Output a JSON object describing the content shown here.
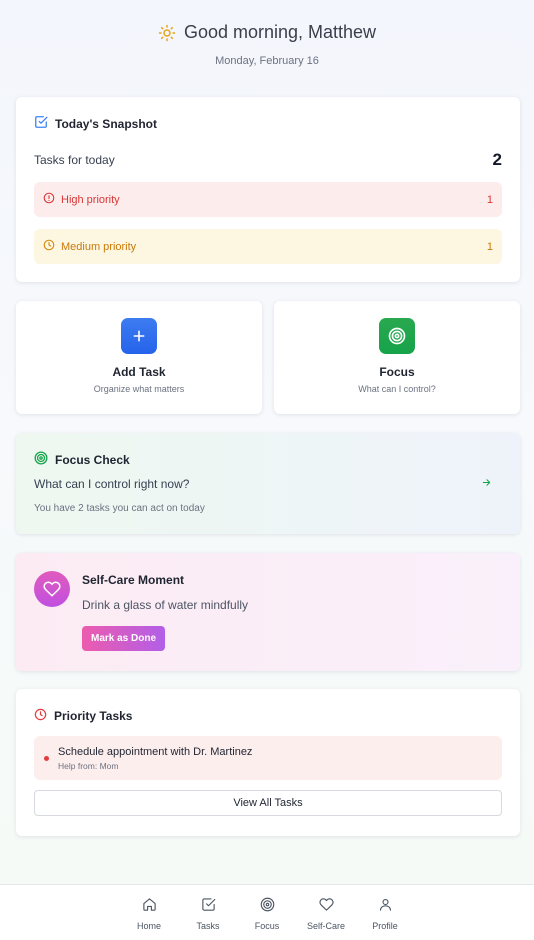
{
  "header": {
    "greeting": "Good morning, Matthew",
    "date": "Monday, February 16",
    "icon": "sun-icon"
  },
  "snapshot": {
    "title": "Today's Snapshot",
    "tasks_label": "Tasks for today",
    "tasks_count": "2",
    "high_label": "High priority",
    "high_count": "1",
    "medium_label": "Medium priority",
    "medium_count": "1"
  },
  "quick_actions": {
    "add_task_title": "Add Task",
    "add_task_sub": "Organize what matters",
    "focus_title": "Focus",
    "focus_sub": "What can I control?"
  },
  "focus_check": {
    "title": "Focus Check",
    "question": "What can I control right now?",
    "note": "You have 2 tasks you can act on today"
  },
  "self_care": {
    "title": "Self-Care Moment",
    "text": "Drink a glass of water mindfully",
    "button": "Mark as Done"
  },
  "priority_tasks": {
    "title": "Priority Tasks",
    "items": [
      {
        "name": "Schedule appointment with Dr. Martinez",
        "help": "Help from: Mom"
      }
    ],
    "view_all": "View All Tasks"
  },
  "nav": [
    {
      "label": "Home",
      "icon": "home-icon"
    },
    {
      "label": "Tasks",
      "icon": "check-square-icon"
    },
    {
      "label": "Focus",
      "icon": "target-icon"
    },
    {
      "label": "Self-Care",
      "icon": "heart-icon"
    },
    {
      "label": "Profile",
      "icon": "user-icon"
    }
  ],
  "colors": {
    "blue_accent": "#2563eb",
    "green_accent": "#16a34a",
    "high_priority": "#d93636",
    "medium_priority": "#c97a0a",
    "pink_accent": "#ec5cae"
  }
}
